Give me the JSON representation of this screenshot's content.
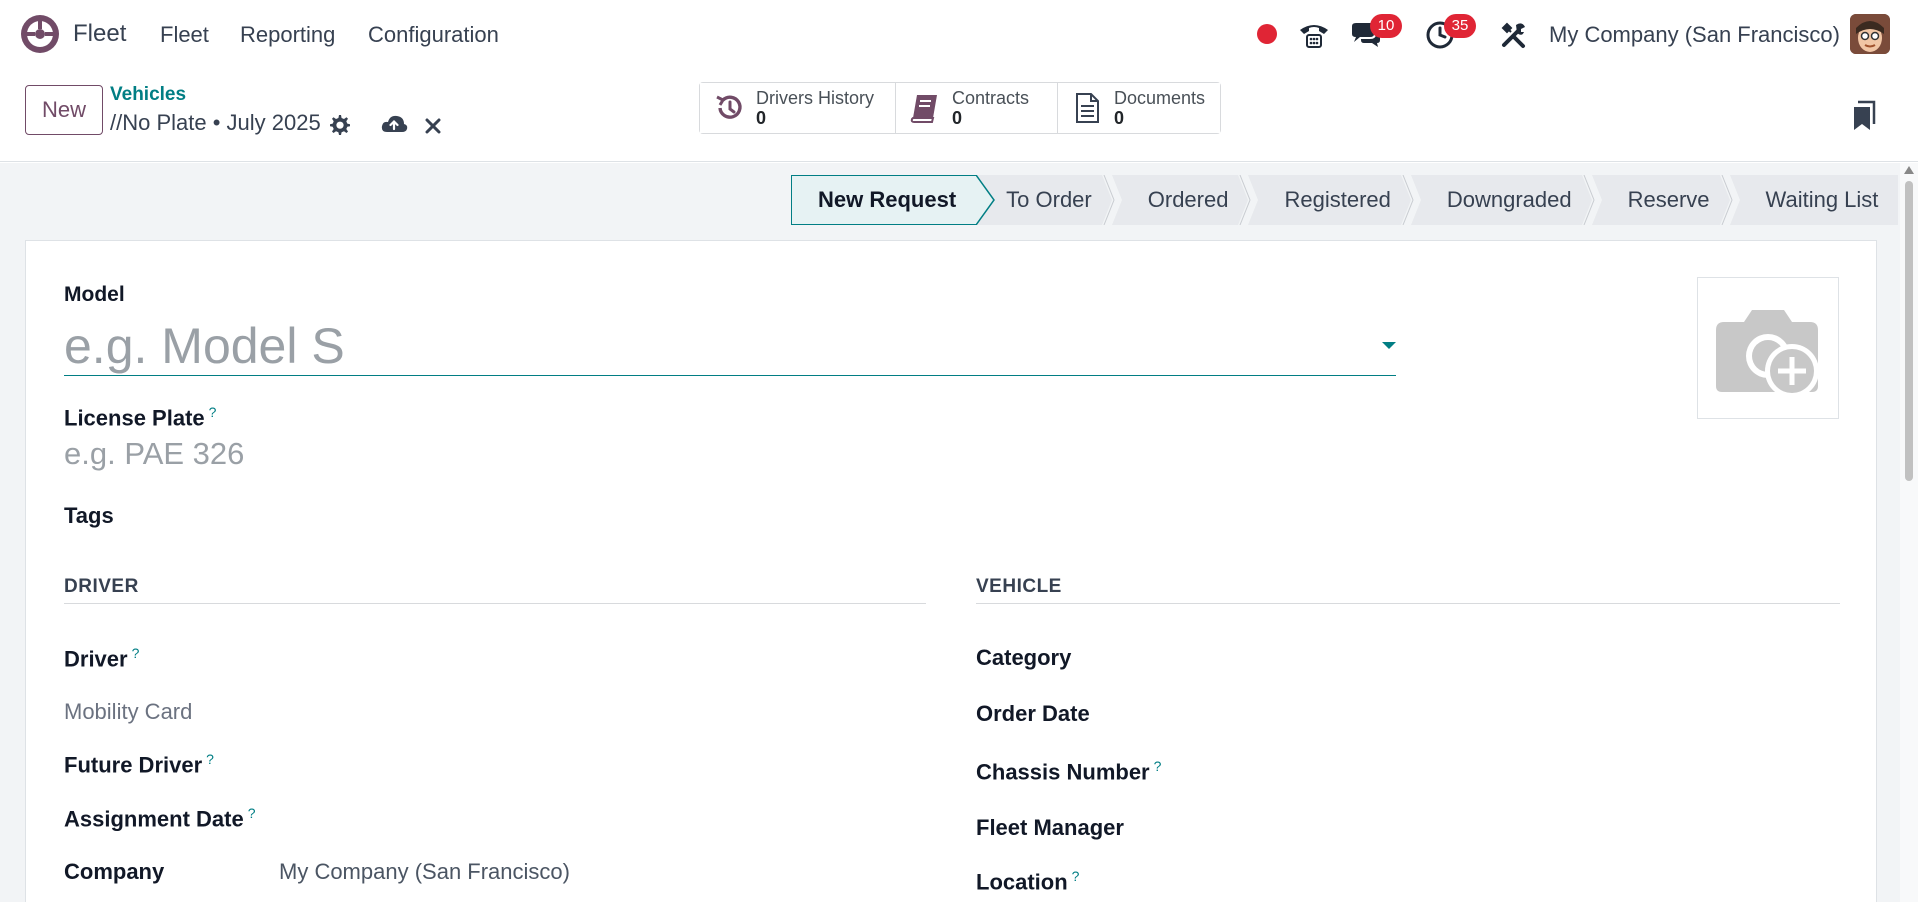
{
  "navbar": {
    "app_name": "Fleet",
    "menu": [
      "Fleet",
      "Reporting",
      "Configuration"
    ],
    "messages_badge": "10",
    "activities_badge": "35",
    "company": "My Company (San Francisco)"
  },
  "control_panel": {
    "new_label": "New",
    "breadcrumb_parent": "Vehicles",
    "breadcrumb_current": "//No Plate • July 2025",
    "smart_buttons": [
      {
        "label": "Drivers History",
        "value": "0",
        "icon": "history-icon"
      },
      {
        "label": "Contracts",
        "value": "0",
        "icon": "book-icon"
      },
      {
        "label": "Documents",
        "value": "0",
        "icon": "document-icon"
      }
    ]
  },
  "statusbar": {
    "stages": [
      "New Request",
      "To Order",
      "Ordered",
      "Registered",
      "Downgraded",
      "Reserve",
      "Waiting List"
    ],
    "active": "New Request"
  },
  "form": {
    "model_label": "Model",
    "model_placeholder": "e.g. Model S",
    "plate_label": "License Plate",
    "plate_help": "?",
    "plate_placeholder": "e.g. PAE 326",
    "tags_label": "Tags",
    "driver_section": {
      "title": "DRIVER",
      "driver_label": "Driver",
      "mobility_card_label": "Mobility Card",
      "future_driver_label": "Future Driver",
      "assignment_date_label": "Assignment Date",
      "company_label": "Company",
      "company_value": "My Company (San Francisco)"
    },
    "vehicle_section": {
      "title": "VEHICLE",
      "category_label": "Category",
      "order_date_label": "Order Date",
      "chassis_label": "Chassis Number",
      "fleet_manager_label": "Fleet Manager",
      "location_label": "Location"
    },
    "help_mark": "?"
  },
  "colors": {
    "brand": "#714b67",
    "accent": "#017e84",
    "badge": "#e02535"
  }
}
